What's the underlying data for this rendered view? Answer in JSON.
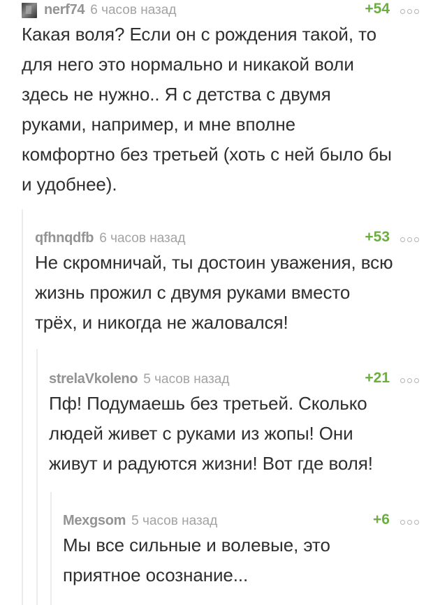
{
  "comments": [
    {
      "user": "nerf74",
      "time": "6 часов назад",
      "rating": "+54",
      "lines": [
        "Какая воля? Если он с рождения такой, то",
        "для него это нормально и никакой воли",
        "здесь не нужно.. Я с детства с двумя",
        "руками, например, и мне вполне",
        "комфортно без третьей (хоть с ней было бы",
        "и удобнее)."
      ]
    },
    {
      "user": "qfhnqdfb",
      "time": "6 часов назад",
      "rating": "+53",
      "lines": [
        "Не скромничай, ты достоин уважения, всю",
        "жизнь прожил с двумя руками вместо",
        "трёх, и никогда не жаловался!"
      ]
    },
    {
      "user": "strelaVkoleno",
      "time": "5 часов назад",
      "rating": "+21",
      "lines": [
        "Пф! Подумаешь без третьей. Сколько",
        "людей живет с руками из жопы! Они",
        "живут и радуются жизни! Вот где воля!"
      ]
    },
    {
      "user": "Mexgsom",
      "time": "5 часов назад",
      "rating": "+6",
      "lines": [
        "Мы все сильные и волевые, это",
        "приятное осознание..."
      ]
    }
  ]
}
